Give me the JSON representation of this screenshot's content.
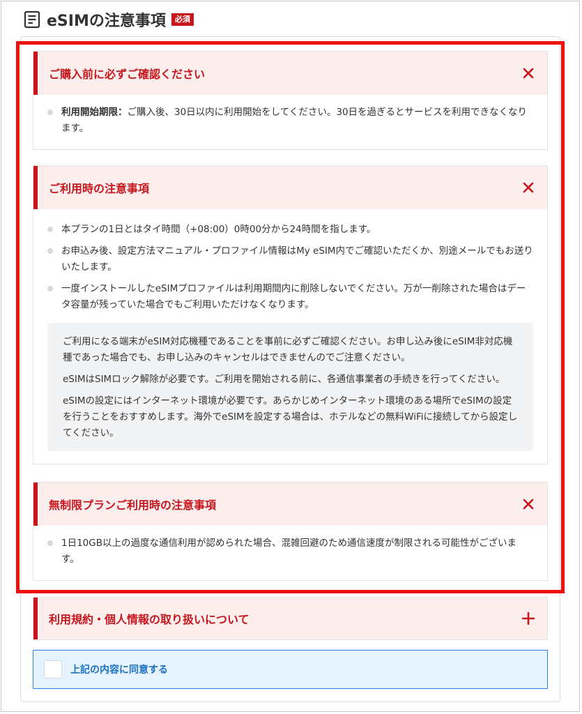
{
  "header": {
    "title": "eSIMの注意事項",
    "badge": "必須"
  },
  "sections": [
    {
      "title": "ご購入前に必ずご確認ください",
      "toggle": "close-icon",
      "items": [
        {
          "label": "利用開始期限：",
          "text": "ご購入後、30日以内に利用開始をしてください。30日を過ぎるとサービスを利用できなくなります。"
        }
      ]
    },
    {
      "title": "ご利用時の注意事項",
      "toggle": "close-icon",
      "items": [
        {
          "text": "本プランの1日とはタイ時間（+08:00）0時00分から24時間を指します。"
        },
        {
          "text": "お申込み後、設定方法マニュアル・プロファイル情報はMy eSIM内でご確認いただくか、別途メールでもお送りいたします。"
        },
        {
          "text": "一度インストールしたeSIMプロファイルは利用期間内に削除しないでください。万が一削除された場合はデータ容量が残っていた場合でもご利用いただけなくなります。"
        }
      ],
      "notes": [
        "ご利用になる端末がeSIM対応機種であることを事前に必ずご確認ください。お申し込み後にeSIM非対応機種であった場合でも、お申し込みのキャンセルはできませんのでご注意ください。",
        "eSIMはSIMロック解除が必要です。ご利用を開始される前に、各通信事業者の手続きを行ってください。",
        "eSIMの設定にはインターネット環境が必要です。あらかじめインターネット環境のある場所でeSIMの設定を行うことをおすすめします。海外でeSIMを設定する場合は、ホテルなどの無料WiFiに接続してから設定してください。"
      ]
    },
    {
      "title": "無制限プランご利用時の注意事項",
      "toggle": "close-icon",
      "items": [
        {
          "text": "1日10GB以上の過度な通信利用が認められた場合、混雑回避のため通信速度が制限される可能性がございます。"
        }
      ]
    },
    {
      "title": "利用規約・個人情報の取り扱いについて",
      "toggle": "plus-icon"
    }
  ],
  "agree": {
    "label": "上記の内容に同意する",
    "checked": false
  },
  "colors": {
    "accent": "#c8161d",
    "highlight_border": "#ee1111",
    "agree_blue": "#1a72c4"
  }
}
